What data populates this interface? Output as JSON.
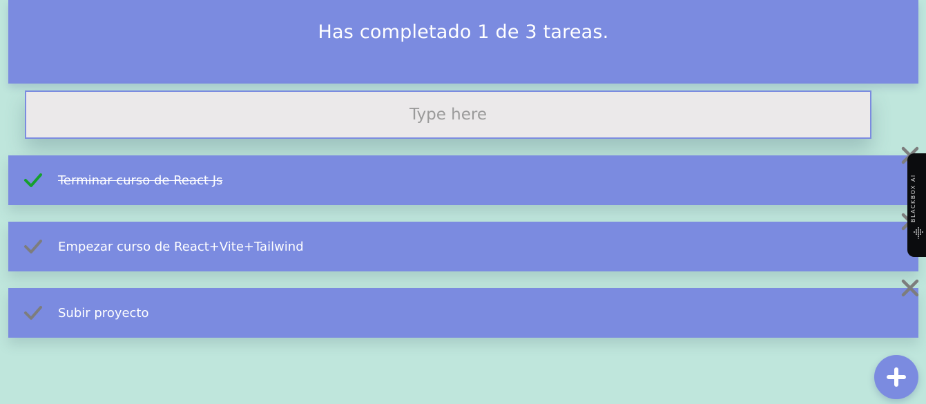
{
  "header": {
    "title": "Has completado 1 de 3 tareas."
  },
  "search": {
    "placeholder": "Type here",
    "value": ""
  },
  "todos": [
    {
      "text": "Terminar curso de React Js",
      "completed": true
    },
    {
      "text": "Empezar curso de React+Vite+Tailwind",
      "completed": false
    },
    {
      "text": "Subir proyecto",
      "completed": false
    }
  ],
  "side_tab": {
    "label": "BLACKBOX AI"
  },
  "icons": {
    "check": "check-icon",
    "delete": "close-icon",
    "add": "plus-icon"
  },
  "colors": {
    "background": "#bfe6dc",
    "accent": "#7b8be0",
    "check_done": "#15a02d",
    "check_pending": "#7d7d7d",
    "delete": "#7d7d7d",
    "input_bg": "#ebe9ea"
  }
}
